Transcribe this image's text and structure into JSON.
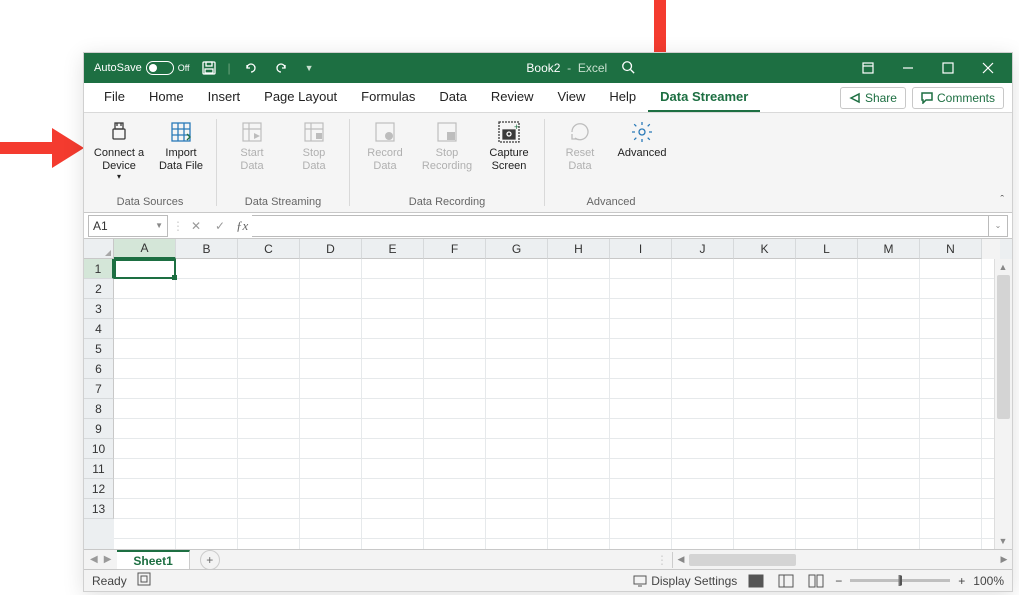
{
  "titlebar": {
    "autosave_label": "AutoSave",
    "autosave_off": "Off",
    "doc_name": "Book2",
    "app_name": "Excel"
  },
  "tabs": {
    "file": "File",
    "home": "Home",
    "insert": "Insert",
    "page_layout": "Page Layout",
    "formulas": "Formulas",
    "data": "Data",
    "review": "Review",
    "view": "View",
    "help": "Help",
    "data_streamer": "Data Streamer"
  },
  "actions": {
    "share": "Share",
    "comments": "Comments"
  },
  "ribbon": {
    "connect_device_1": "Connect a",
    "connect_device_2": "Device",
    "import_1": "Import",
    "import_2": "Data File",
    "start_1": "Start",
    "start_2": "Data",
    "stop_1": "Stop",
    "stop_2": "Data",
    "record_1": "Record",
    "record_2": "Data",
    "stoprec_1": "Stop",
    "stoprec_2": "Recording",
    "capture_1": "Capture",
    "capture_2": "Screen",
    "reset_1": "Reset",
    "reset_2": "Data",
    "advanced_1": "Advanced",
    "group_sources": "Data Sources",
    "group_streaming": "Data Streaming",
    "group_recording": "Data Recording",
    "group_advanced": "Advanced"
  },
  "namebox": {
    "value": "A1"
  },
  "columns": [
    "A",
    "B",
    "C",
    "D",
    "E",
    "F",
    "G",
    "H",
    "I",
    "J",
    "K",
    "L",
    "M",
    "N"
  ],
  "rows": [
    "1",
    "2",
    "3",
    "4",
    "5",
    "6",
    "7",
    "8",
    "9",
    "10",
    "11",
    "12",
    "13"
  ],
  "sheet_tab": "Sheet1",
  "status": {
    "ready": "Ready",
    "display_settings": "Display Settings",
    "zoom": "100%"
  }
}
